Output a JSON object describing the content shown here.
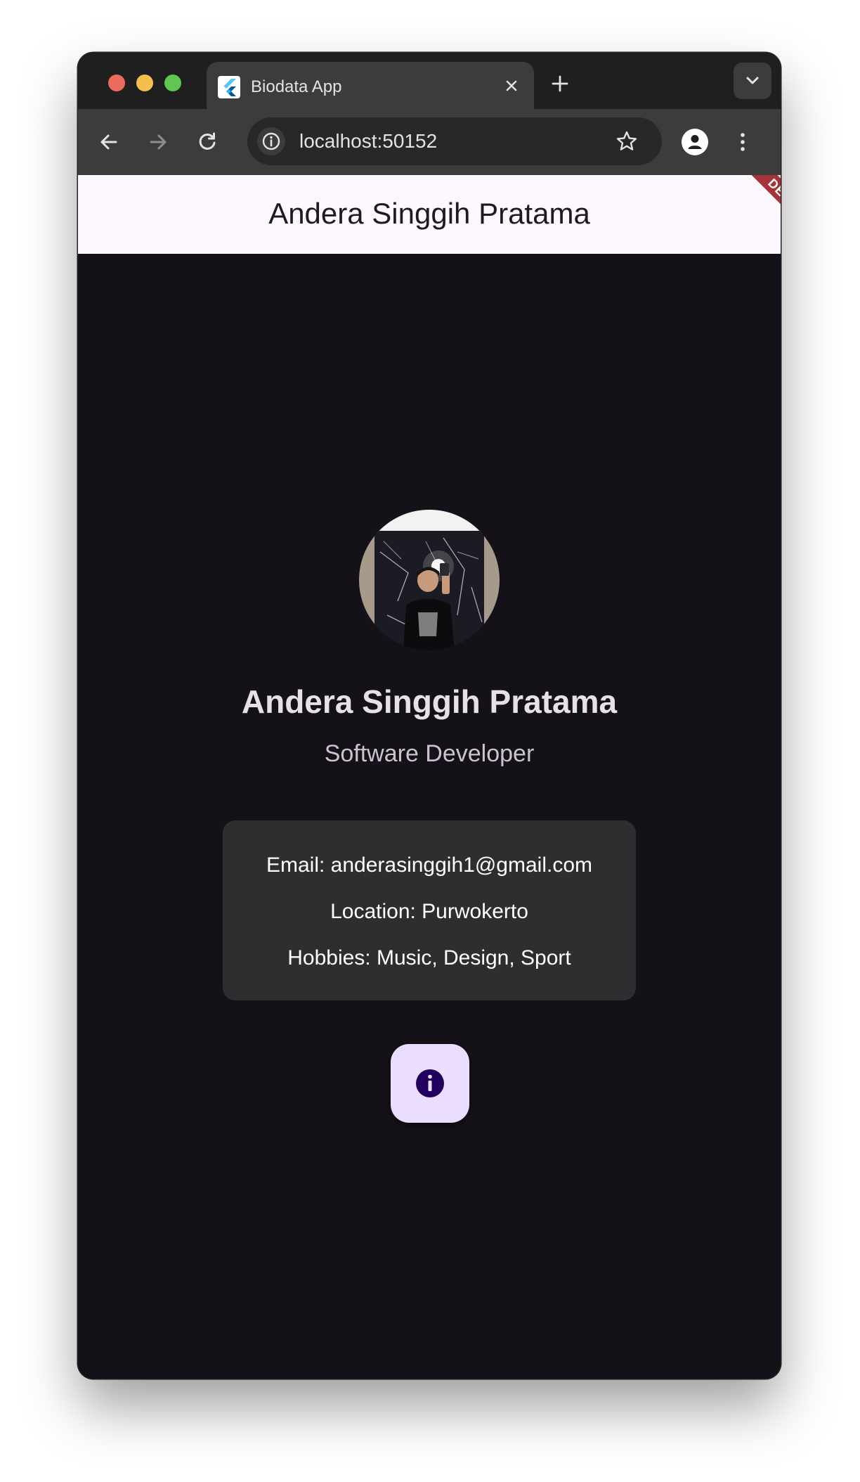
{
  "browser": {
    "tab_title": "Biodata App",
    "url": "localhost:50152"
  },
  "app": {
    "appbar_title": "Andera Singgih Pratama",
    "debug_banner": "DEBUG",
    "profile": {
      "name": "Andera Singgih Pratama",
      "role": "Software Developer"
    },
    "info": {
      "email": "Email: anderasinggih1@gmail.com",
      "location": "Location: Purwokerto",
      "hobbies": "Hobbies: Music, Design, Sport"
    },
    "fab_icon": "info-icon"
  },
  "colors": {
    "app_background": "#141218",
    "appbar_background": "#fdf7ff",
    "card_background": "#2e2e30",
    "fab_background": "#eaddff",
    "fab_icon": "#21005d",
    "debug_banner": "#a4343a"
  }
}
